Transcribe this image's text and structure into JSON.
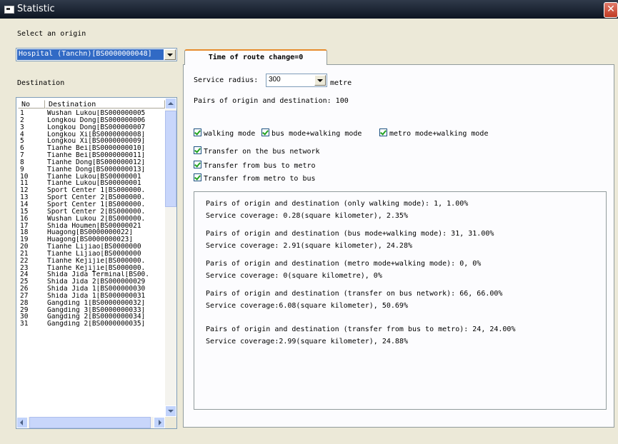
{
  "window": {
    "title": "Statistic",
    "close_label": "✕"
  },
  "origin": {
    "label": "Select an origin",
    "selected": "Hospital (Tanchn)[BS0000000048]"
  },
  "destination": {
    "label": "Destination",
    "columns": [
      "No",
      "Destination"
    ],
    "rows": [
      [
        "1",
        "Wushan Lukou[BS000000005"
      ],
      [
        "2",
        "Longkou Dong[BS000000006"
      ],
      [
        "3",
        "Longkou Dong[BS000000007"
      ],
      [
        "4",
        "Longkou Xi[BS0000000008]"
      ],
      [
        "5",
        "Longkou Xi[BS0000000009]"
      ],
      [
        "6",
        "Tianhe Bei[BS0000000010]"
      ],
      [
        "7",
        "Tianhe Bei[BS0000000011]"
      ],
      [
        "8",
        "Tianhe Dong[BS000000012]"
      ],
      [
        "9",
        "Tianhe Dong[BS000000013]"
      ],
      [
        "10",
        "Tianhe Lukou[BS00000001"
      ],
      [
        "11",
        "Tianhe Lukou[BS00000001"
      ],
      [
        "12",
        "Sport Center 1[BS000000."
      ],
      [
        "13",
        "Sport Center 2[BS000000."
      ],
      [
        "14",
        "Sport Center 1[BS000000."
      ],
      [
        "15",
        "Sport Center 2[BS000000."
      ],
      [
        "16",
        "Wushan Lukou 2[BS000000."
      ],
      [
        "17",
        "Shida Houmen[BS00000021"
      ],
      [
        "18",
        "Huagong[BS0000000022]"
      ],
      [
        "19",
        "Huagong[BS0000000023]"
      ],
      [
        "20",
        "Tianhe Lijiao[BS0000000"
      ],
      [
        "21",
        "Tianhe Lijiao[BS0000000"
      ],
      [
        "22",
        "Tianhe Kejijie[BS000000."
      ],
      [
        "23",
        "Tianhe Kejijie[BS000000."
      ],
      [
        "24",
        "Shida Jida Terminal[BS00."
      ],
      [
        "25",
        "Shida Jida 2[BS000000029"
      ],
      [
        "26",
        "Shida Jida 1[BS000000030"
      ],
      [
        "27",
        "Shida Jida 1[BS000000031"
      ],
      [
        "28",
        "Gangding 1[BS0000000032]"
      ],
      [
        "29",
        "Gangding 3[BS0000000033]"
      ],
      [
        "30",
        "Gangding 2[BS0000000034]"
      ],
      [
        "31",
        "Gangding 2[BS0000000035]"
      ]
    ]
  },
  "tab": {
    "label": "Time of route change=0"
  },
  "service_radius": {
    "label": "Service radius:",
    "value": "300",
    "unit": "metre"
  },
  "pairs_total": "Pairs of origin and destination: 100",
  "modes": [
    "walking mode",
    "bus mode+walking mode",
    "metro mode+walking mode"
  ],
  "transfers": [
    "Transfer on the bus network",
    "Transfer from bus to metro",
    "Transfer from metro to bus"
  ],
  "results": [
    {
      "pairs": "Pairs of origin and destination (only walking mode): 1,   1.00%",
      "coverage": "Service coverage: 0.28(square kilometer),   2.35%"
    },
    {
      "pairs": "Pairs of origin and destination (bus mode+walking mode): 31,   31.00%",
      "coverage": "Service coverage: 2.91(square kilometer),   24.28%"
    },
    {
      "pairs": "Paris of origin and destination (metro mode+walking mode): 0,   0%",
      "coverage": "Service coverage: 0(square kilometre),   0%"
    },
    {
      "pairs": "Pairs of origin and destination (transfer on bus network): 66,   66.00%",
      "coverage": "Service coverage:6.08(square kilometer),   50.69%"
    },
    {
      "pairs": "Pairs of origin and destination (transfer from bus to metro): 24,   24.00%",
      "coverage": "Service coverage:2.99(square kilometer),   24.88%"
    }
  ]
}
